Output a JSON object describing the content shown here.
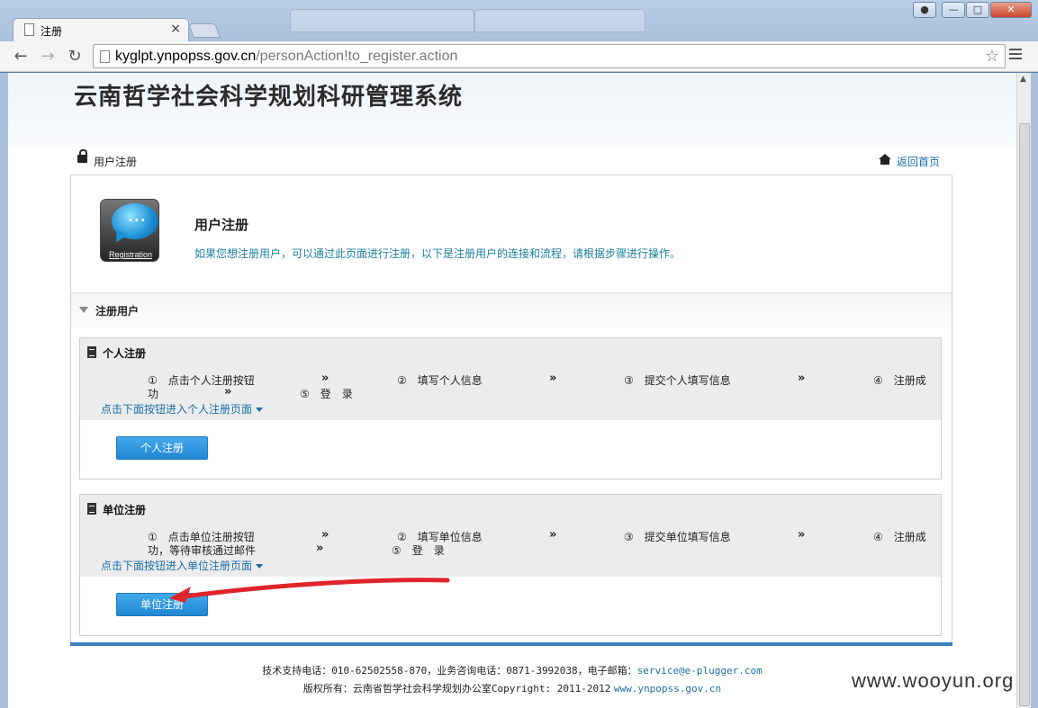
{
  "browser": {
    "tab_title": "注册",
    "tab_close": "×",
    "url_host": "kyglpt.ynpopss.gov.cn",
    "url_path": "/personAction!to_register.action",
    "back": "←",
    "forward": "→",
    "reload": "↻",
    "star": "☆",
    "win_min": "—",
    "win_max": "□",
    "win_close": "✕"
  },
  "header": {
    "system_title": "云南哲学社会科学规划科研管理系统"
  },
  "breadcrumb": {
    "current": "用户注册",
    "home_link": "返回首页"
  },
  "intro": {
    "logo_text": "Registration",
    "title": "用户注册",
    "description": "如果您想注册用户，可以通过此页面进行注册，以下是注册用户的连接和流程，请根据步骤进行操作。"
  },
  "section": {
    "label": "注册用户"
  },
  "personal": {
    "title": "个人注册",
    "step1a": "①　点击个人注册按钮",
    "step1b": "功",
    "step2": "②　填写个人信息",
    "step3": "③　提交个人填写信息",
    "step4": "④　注册成",
    "step5": "⑤　登　录",
    "arrow": "»",
    "hint": "点击下面按钮进入个人注册页面",
    "button": "个人注册"
  },
  "unit": {
    "title": "单位注册",
    "step1a": "①　点击单位注册按钮",
    "step1b": "功，等待审核通过邮件",
    "step2": "②　填写单位信息",
    "step3": "③　提交单位填写信息",
    "step4": "④　注册成",
    "step5": "⑤　登　录",
    "arrow": "»",
    "hint": "点击下面按钮进入单位注册页面",
    "button": "单位注册"
  },
  "footer": {
    "line1_label": "技术支持电话：",
    "line1_support": "010-62502558-870",
    "line1_mid": "，业务咨询电话：",
    "line1_business": "0871-3992038",
    "line1_email_label": "，电子邮箱：",
    "line1_email": "service@e-plugger.com",
    "line2_label": "版权所有：云南省哲学社会科学规划办公室",
    "line2_copyright": "Copyright: 2011-2012",
    "line2_site": "www.ynpopss.gov.cn"
  },
  "watermark": "www.wooyun.org",
  "colors": {
    "accent_blue": "#1f86d3",
    "link_blue": "#1a6fa8",
    "annotation_red": "#e0252a"
  }
}
